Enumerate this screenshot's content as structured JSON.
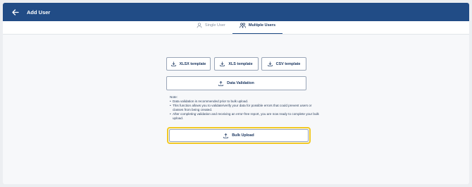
{
  "header": {
    "back_icon": "arrow-left-icon",
    "title": "Add User",
    "bg_color": "#214c86"
  },
  "tabs": [
    {
      "label": "Single User",
      "icon": "person-icon",
      "active": false
    },
    {
      "label": "Multiple Users",
      "icon": "people-icon",
      "active": true
    }
  ],
  "templates": {
    "xlsx_label": "XLSX template",
    "xls_label": "XLS template",
    "csv_label": "CSV template"
  },
  "validation": {
    "label": "Data Validation"
  },
  "note": {
    "title": "Note:",
    "items": [
      "Data validation is recommended prior to bulk upload.",
      "This function allows you to validate/verify your data for possible errors that could prevent users or classes from being created.",
      "After completing validation and receiving an error-free report, you are now ready to complete your bulk upload."
    ]
  },
  "bulk_upload": {
    "label": "Bulk Upload",
    "highlight_color": "#f2c924"
  }
}
